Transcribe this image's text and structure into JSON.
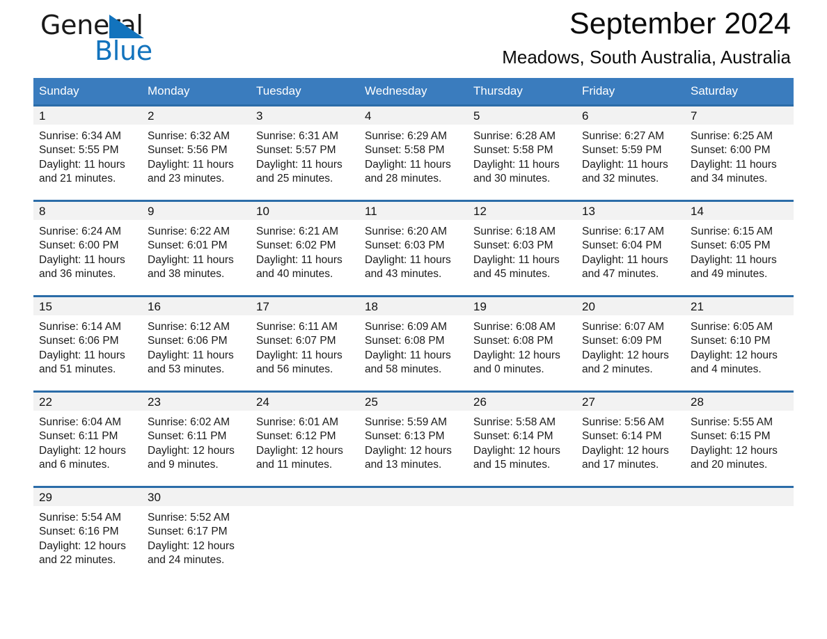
{
  "brand": {
    "name_part1": "General",
    "name_part2": "Blue",
    "triangle_color": "#1273bd"
  },
  "header": {
    "title": "September 2024",
    "subtitle": "Meadows, South Australia, Australia"
  },
  "colors": {
    "header_blue": "#3a7cbe",
    "row_rule_blue": "#2b6ca8",
    "daynum_band": "#f2f2f2",
    "text": "#1a1a1a"
  },
  "weekdays": [
    "Sunday",
    "Monday",
    "Tuesday",
    "Wednesday",
    "Thursday",
    "Friday",
    "Saturday"
  ],
  "weeks": [
    [
      {
        "day": "1",
        "sunrise": "Sunrise: 6:34 AM",
        "sunset": "Sunset: 5:55 PM",
        "daylight": "Daylight: 11 hours and 21 minutes."
      },
      {
        "day": "2",
        "sunrise": "Sunrise: 6:32 AM",
        "sunset": "Sunset: 5:56 PM",
        "daylight": "Daylight: 11 hours and 23 minutes."
      },
      {
        "day": "3",
        "sunrise": "Sunrise: 6:31 AM",
        "sunset": "Sunset: 5:57 PM",
        "daylight": "Daylight: 11 hours and 25 minutes."
      },
      {
        "day": "4",
        "sunrise": "Sunrise: 6:29 AM",
        "sunset": "Sunset: 5:58 PM",
        "daylight": "Daylight: 11 hours and 28 minutes."
      },
      {
        "day": "5",
        "sunrise": "Sunrise: 6:28 AM",
        "sunset": "Sunset: 5:58 PM",
        "daylight": "Daylight: 11 hours and 30 minutes."
      },
      {
        "day": "6",
        "sunrise": "Sunrise: 6:27 AM",
        "sunset": "Sunset: 5:59 PM",
        "daylight": "Daylight: 11 hours and 32 minutes."
      },
      {
        "day": "7",
        "sunrise": "Sunrise: 6:25 AM",
        "sunset": "Sunset: 6:00 PM",
        "daylight": "Daylight: 11 hours and 34 minutes."
      }
    ],
    [
      {
        "day": "8",
        "sunrise": "Sunrise: 6:24 AM",
        "sunset": "Sunset: 6:00 PM",
        "daylight": "Daylight: 11 hours and 36 minutes."
      },
      {
        "day": "9",
        "sunrise": "Sunrise: 6:22 AM",
        "sunset": "Sunset: 6:01 PM",
        "daylight": "Daylight: 11 hours and 38 minutes."
      },
      {
        "day": "10",
        "sunrise": "Sunrise: 6:21 AM",
        "sunset": "Sunset: 6:02 PM",
        "daylight": "Daylight: 11 hours and 40 minutes."
      },
      {
        "day": "11",
        "sunrise": "Sunrise: 6:20 AM",
        "sunset": "Sunset: 6:03 PM",
        "daylight": "Daylight: 11 hours and 43 minutes."
      },
      {
        "day": "12",
        "sunrise": "Sunrise: 6:18 AM",
        "sunset": "Sunset: 6:03 PM",
        "daylight": "Daylight: 11 hours and 45 minutes."
      },
      {
        "day": "13",
        "sunrise": "Sunrise: 6:17 AM",
        "sunset": "Sunset: 6:04 PM",
        "daylight": "Daylight: 11 hours and 47 minutes."
      },
      {
        "day": "14",
        "sunrise": "Sunrise: 6:15 AM",
        "sunset": "Sunset: 6:05 PM",
        "daylight": "Daylight: 11 hours and 49 minutes."
      }
    ],
    [
      {
        "day": "15",
        "sunrise": "Sunrise: 6:14 AM",
        "sunset": "Sunset: 6:06 PM",
        "daylight": "Daylight: 11 hours and 51 minutes."
      },
      {
        "day": "16",
        "sunrise": "Sunrise: 6:12 AM",
        "sunset": "Sunset: 6:06 PM",
        "daylight": "Daylight: 11 hours and 53 minutes."
      },
      {
        "day": "17",
        "sunrise": "Sunrise: 6:11 AM",
        "sunset": "Sunset: 6:07 PM",
        "daylight": "Daylight: 11 hours and 56 minutes."
      },
      {
        "day": "18",
        "sunrise": "Sunrise: 6:09 AM",
        "sunset": "Sunset: 6:08 PM",
        "daylight": "Daylight: 11 hours and 58 minutes."
      },
      {
        "day": "19",
        "sunrise": "Sunrise: 6:08 AM",
        "sunset": "Sunset: 6:08 PM",
        "daylight": "Daylight: 12 hours and 0 minutes."
      },
      {
        "day": "20",
        "sunrise": "Sunrise: 6:07 AM",
        "sunset": "Sunset: 6:09 PM",
        "daylight": "Daylight: 12 hours and 2 minutes."
      },
      {
        "day": "21",
        "sunrise": "Sunrise: 6:05 AM",
        "sunset": "Sunset: 6:10 PM",
        "daylight": "Daylight: 12 hours and 4 minutes."
      }
    ],
    [
      {
        "day": "22",
        "sunrise": "Sunrise: 6:04 AM",
        "sunset": "Sunset: 6:11 PM",
        "daylight": "Daylight: 12 hours and 6 minutes."
      },
      {
        "day": "23",
        "sunrise": "Sunrise: 6:02 AM",
        "sunset": "Sunset: 6:11 PM",
        "daylight": "Daylight: 12 hours and 9 minutes."
      },
      {
        "day": "24",
        "sunrise": "Sunrise: 6:01 AM",
        "sunset": "Sunset: 6:12 PM",
        "daylight": "Daylight: 12 hours and 11 minutes."
      },
      {
        "day": "25",
        "sunrise": "Sunrise: 5:59 AM",
        "sunset": "Sunset: 6:13 PM",
        "daylight": "Daylight: 12 hours and 13 minutes."
      },
      {
        "day": "26",
        "sunrise": "Sunrise: 5:58 AM",
        "sunset": "Sunset: 6:14 PM",
        "daylight": "Daylight: 12 hours and 15 minutes."
      },
      {
        "day": "27",
        "sunrise": "Sunrise: 5:56 AM",
        "sunset": "Sunset: 6:14 PM",
        "daylight": "Daylight: 12 hours and 17 minutes."
      },
      {
        "day": "28",
        "sunrise": "Sunrise: 5:55 AM",
        "sunset": "Sunset: 6:15 PM",
        "daylight": "Daylight: 12 hours and 20 minutes."
      }
    ],
    [
      {
        "day": "29",
        "sunrise": "Sunrise: 5:54 AM",
        "sunset": "Sunset: 6:16 PM",
        "daylight": "Daylight: 12 hours and 22 minutes."
      },
      {
        "day": "30",
        "sunrise": "Sunrise: 5:52 AM",
        "sunset": "Sunset: 6:17 PM",
        "daylight": "Daylight: 12 hours and 24 minutes."
      },
      {
        "day": "",
        "sunrise": "",
        "sunset": "",
        "daylight": ""
      },
      {
        "day": "",
        "sunrise": "",
        "sunset": "",
        "daylight": ""
      },
      {
        "day": "",
        "sunrise": "",
        "sunset": "",
        "daylight": ""
      },
      {
        "day": "",
        "sunrise": "",
        "sunset": "",
        "daylight": ""
      },
      {
        "day": "",
        "sunrise": "",
        "sunset": "",
        "daylight": ""
      }
    ]
  ]
}
